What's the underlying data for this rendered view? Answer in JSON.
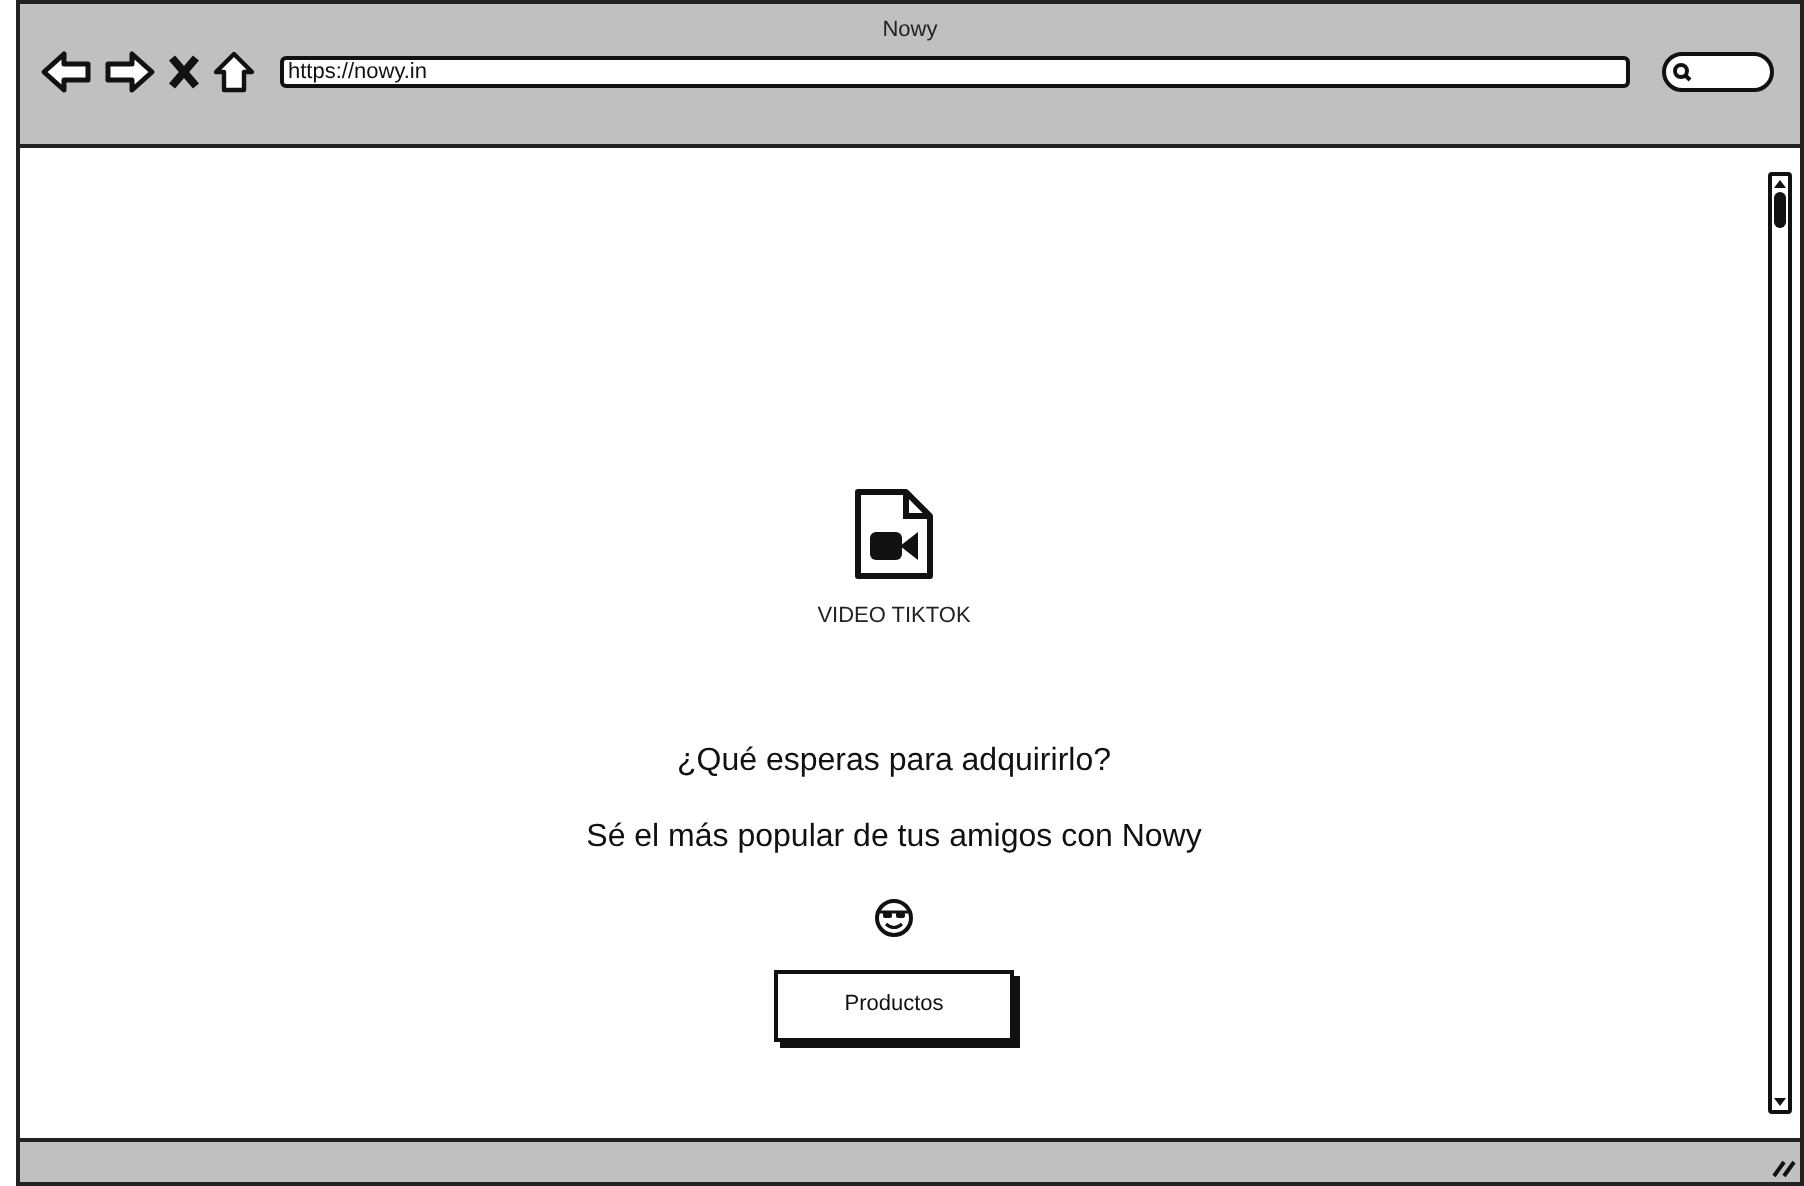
{
  "window": {
    "title": "Nowy"
  },
  "address_bar": {
    "value": "https://nowy.in"
  },
  "content": {
    "media_label": "VIDEO TIKTOK",
    "heading": "¿Qué esperas para adquirirlo?",
    "tagline": "Sé el más popular de tus amigos con Nowy",
    "button": "Productos"
  }
}
